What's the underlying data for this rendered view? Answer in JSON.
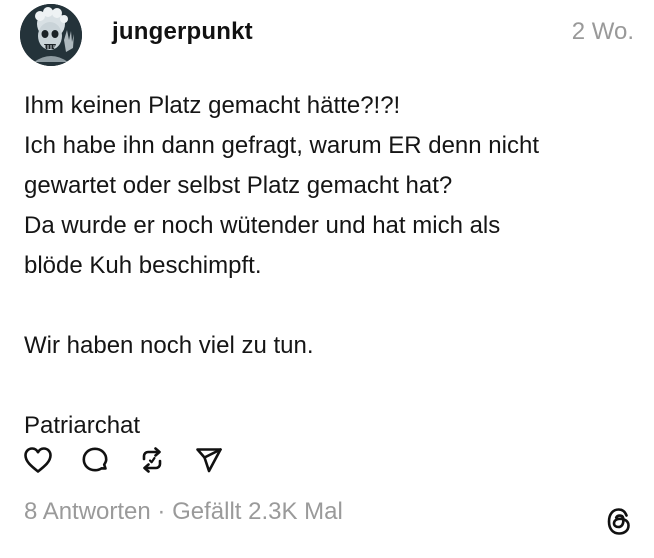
{
  "post": {
    "username": "jungerpunkt",
    "timestamp": "2 Wo.",
    "lines": [
      "Ihm keinen Platz gemacht hätte?!?!",
      "Ich habe ihn dann gefragt, warum ER denn nicht",
      "gewartet oder selbst Platz gemacht hat?",
      "Da wurde er noch wütender und hat mich als",
      "blöde Kuh beschimpft.",
      "",
      "Wir haben noch viel zu tun.",
      "",
      "Patriarchat"
    ],
    "stats": "8 Antworten · Gefällt 2.3K Mal"
  },
  "actions": {
    "icons": [
      "heart-icon",
      "comment-icon",
      "repost-icon",
      "share-icon"
    ]
  },
  "branding": {
    "logo": "threads-logo"
  },
  "colors": {
    "text": "#151515",
    "muted": "#999999"
  }
}
